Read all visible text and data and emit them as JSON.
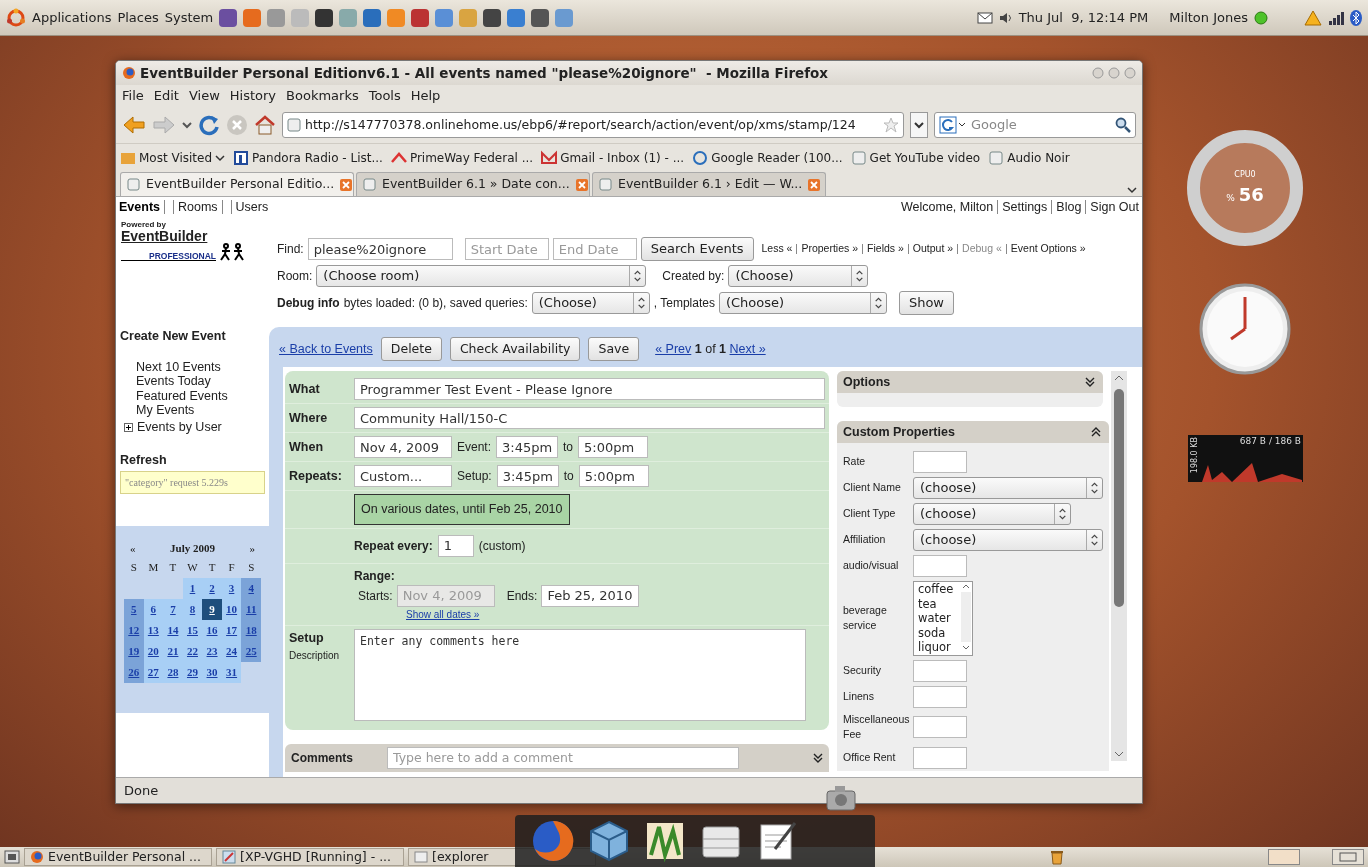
{
  "top_panel": {
    "menus": [
      "Applications",
      "Places",
      "System"
    ],
    "clock": "Thu Jul  9, 12:14 PM",
    "user": "Milton Jones"
  },
  "window": {
    "title": "EventBuilder Personal Editionv6.1 - All events named \"please%20ignore\"  - Mozilla Firefox",
    "menu": [
      "File",
      "Edit",
      "View",
      "History",
      "Bookmarks",
      "Tools",
      "Help"
    ],
    "url": "http://s147770378.onlinehome.us/ebp6/#report/search/action/event/op/xms/stamp/124",
    "search_placeholder": "Google",
    "bookmarks": [
      {
        "label": "Most Visited",
        "kind": "folder"
      },
      {
        "label": "Pandora Radio - List...",
        "kind": "pandora"
      },
      {
        "label": "PrimeWay Federal ...",
        "kind": "bank"
      },
      {
        "label": "Gmail - Inbox (1) - ...",
        "kind": "mail"
      },
      {
        "label": "Google Reader (100...",
        "kind": "reader"
      },
      {
        "label": "Get YouTube video",
        "kind": "page"
      },
      {
        "label": "Audio Noir",
        "kind": "page"
      }
    ],
    "tabs": [
      {
        "label": "EventBuilder Personal Editio...",
        "selected": true
      },
      {
        "label": "EventBuilder 6.1 » Date con...",
        "selected": false
      },
      {
        "label": "EventBuilder 6.1 › Edit — W...",
        "selected": false
      }
    ],
    "status": "Done"
  },
  "page": {
    "nav": [
      {
        "label": "Events",
        "selected": true
      },
      {
        "label": "Rooms",
        "selected": false
      },
      {
        "label": "Users",
        "selected": false
      }
    ],
    "welcome": "Welcome, Milton",
    "account_links": [
      "Settings",
      "Blog",
      "Sign Out"
    ],
    "logo": {
      "top": "Powered by",
      "name": "EventBuilder",
      "edition": "PROFESSIONAL"
    },
    "search": {
      "find_label": "Find:",
      "find_value": "please%20ignore",
      "start_placeholder": "Start Date",
      "end_placeholder": "End Date",
      "button": "Search Events",
      "links": [
        {
          "label": "Less «",
          "disabled": false
        },
        {
          "label": "Properties »",
          "disabled": false
        },
        {
          "label": "Fields »",
          "disabled": false
        },
        {
          "label": "Output »",
          "disabled": false
        },
        {
          "label": "Debug «",
          "disabled": true
        },
        {
          "label": "Event Options »",
          "disabled": false
        }
      ],
      "room_label": "Room:",
      "room_value": "(Choose room)",
      "created_label": "Created by:",
      "created_value": "(Choose)",
      "debug_label": "Debug info",
      "debug_text": "bytes loaded: (0 b), saved queries:",
      "queries_value": "(Choose)",
      "templates_label": ", Templates",
      "templates_value": "(Choose)",
      "show_button": "Show"
    },
    "sidebar": {
      "create": "Create New Event",
      "links": [
        "Next 10 Events",
        "Events Today",
        "Featured Events",
        "My Events"
      ],
      "tree_item": {
        "label": "Events by User",
        "expanded": false
      },
      "refresh": "Refresh",
      "note": "\"category\" request 5.229s",
      "calendar": {
        "prev": "«",
        "month": "July",
        "year": "2009",
        "next": "»",
        "weekdays": [
          "S",
          "M",
          "T",
          "W",
          "T",
          "F",
          "S"
        ],
        "weeks": [
          [
            {
              "kind": "blank"
            },
            {
              "kind": "blank"
            },
            {
              "kind": "blank"
            },
            {
              "day": "1",
              "selected": false
            },
            {
              "day": "2",
              "selected": false
            },
            {
              "day": "3",
              "selected": false
            },
            {
              "day": "4",
              "selected": false
            }
          ],
          [
            {
              "day": "5",
              "selected": false
            },
            {
              "day": "6",
              "selected": false
            },
            {
              "day": "7",
              "selected": false
            },
            {
              "day": "8",
              "selected": false
            },
            {
              "day": "9",
              "selected": true
            },
            {
              "day": "10",
              "selected": false
            },
            {
              "day": "11",
              "selected": false
            }
          ],
          [
            {
              "day": "12",
              "selected": false
            },
            {
              "day": "13",
              "selected": false
            },
            {
              "day": "14",
              "selected": false
            },
            {
              "day": "15",
              "selected": false
            },
            {
              "day": "16",
              "selected": false
            },
            {
              "day": "17",
              "selected": false
            },
            {
              "day": "18",
              "selected": false
            }
          ],
          [
            {
              "day": "19",
              "selected": false
            },
            {
              "day": "20",
              "selected": false
            },
            {
              "day": "21",
              "selected": false
            },
            {
              "day": "22",
              "selected": false
            },
            {
              "day": "23",
              "selected": false
            },
            {
              "day": "24",
              "selected": false
            },
            {
              "day": "25",
              "selected": false
            }
          ],
          [
            {
              "day": "26",
              "selected": false
            },
            {
              "day": "27",
              "selected": false
            },
            {
              "day": "28",
              "selected": false
            },
            {
              "day": "29",
              "selected": false
            },
            {
              "day": "30",
              "selected": false
            },
            {
              "day": "31",
              "selected": false
            },
            {
              "kind": "blank"
            }
          ]
        ]
      }
    },
    "toolbar": {
      "back": "« Back to Events",
      "buttons": [
        "Delete",
        "Check Availability",
        "Save"
      ],
      "prev": "« Prev",
      "current": "1",
      "of": "of",
      "total": "1",
      "next": "Next »"
    },
    "form": {
      "what": {
        "label": "What",
        "value": "Programmer Test Event - Please Ignore"
      },
      "where": {
        "label": "Where",
        "value": "Community Hall/150-C"
      },
      "when": {
        "label": "When",
        "value": "Nov 4, 2009",
        "sub_label": "Event:",
        "start": "3:45pm",
        "to": "to",
        "end": "5:00pm"
      },
      "repeats": {
        "label": "Repeats:",
        "value": "Custom...",
        "sub_label": "Setup:",
        "start": "3:45pm",
        "to": "to",
        "end": "5:00pm"
      },
      "summary": "On various dates, until Feb 25, 2010",
      "repeat_every": {
        "label": "Repeat every:",
        "value": "1",
        "note": "(custom)"
      },
      "range": {
        "label": "Range:",
        "starts_label": "Starts:",
        "starts": "Nov 4, 2009",
        "starts_disabled": true,
        "ends_label": "Ends:",
        "ends": "Feb 25, 2010",
        "link": "Show all dates »"
      },
      "setup": {
        "label": "Setup",
        "link": "Description",
        "value": "Enter any comments here"
      }
    },
    "comments": {
      "label": "Comments",
      "placeholder": "Type here to add a comment",
      "expanded": false
    },
    "options": {
      "title": "Options",
      "expanded": false
    },
    "custom_properties": {
      "title": "Custom Properties",
      "expanded": true,
      "rows": [
        {
          "label": "Rate",
          "kind": "text"
        },
        {
          "label": "Client Name",
          "kind": "select",
          "value": "(choose)"
        },
        {
          "label": "Client Type",
          "kind": "shortselect",
          "value": "(choose)"
        },
        {
          "label": "Affiliation",
          "kind": "select",
          "value": "(choose)"
        },
        {
          "label": "audio/visual",
          "kind": "text"
        },
        {
          "label": "beverage service",
          "kind": "list",
          "options": [
            "coffee",
            "tea",
            "water",
            "soda",
            "liquor"
          ]
        },
        {
          "label": "Security",
          "kind": "text"
        },
        {
          "label": "Linens",
          "kind": "text"
        },
        {
          "label": "Miscellaneous Fee",
          "kind": "text"
        },
        {
          "label": "Office Rent",
          "kind": "text"
        }
      ]
    }
  },
  "widgets": {
    "cpu": {
      "label": "CPU0",
      "unit": "%",
      "value": "56"
    },
    "network": {
      "rate": "687 B / 186 B",
      "total": "198.0 KB"
    }
  },
  "taskbar": [
    "EventBuilder Personal ...",
    "[XP-VGHD [Running] - ...",
    "[explorer"
  ]
}
